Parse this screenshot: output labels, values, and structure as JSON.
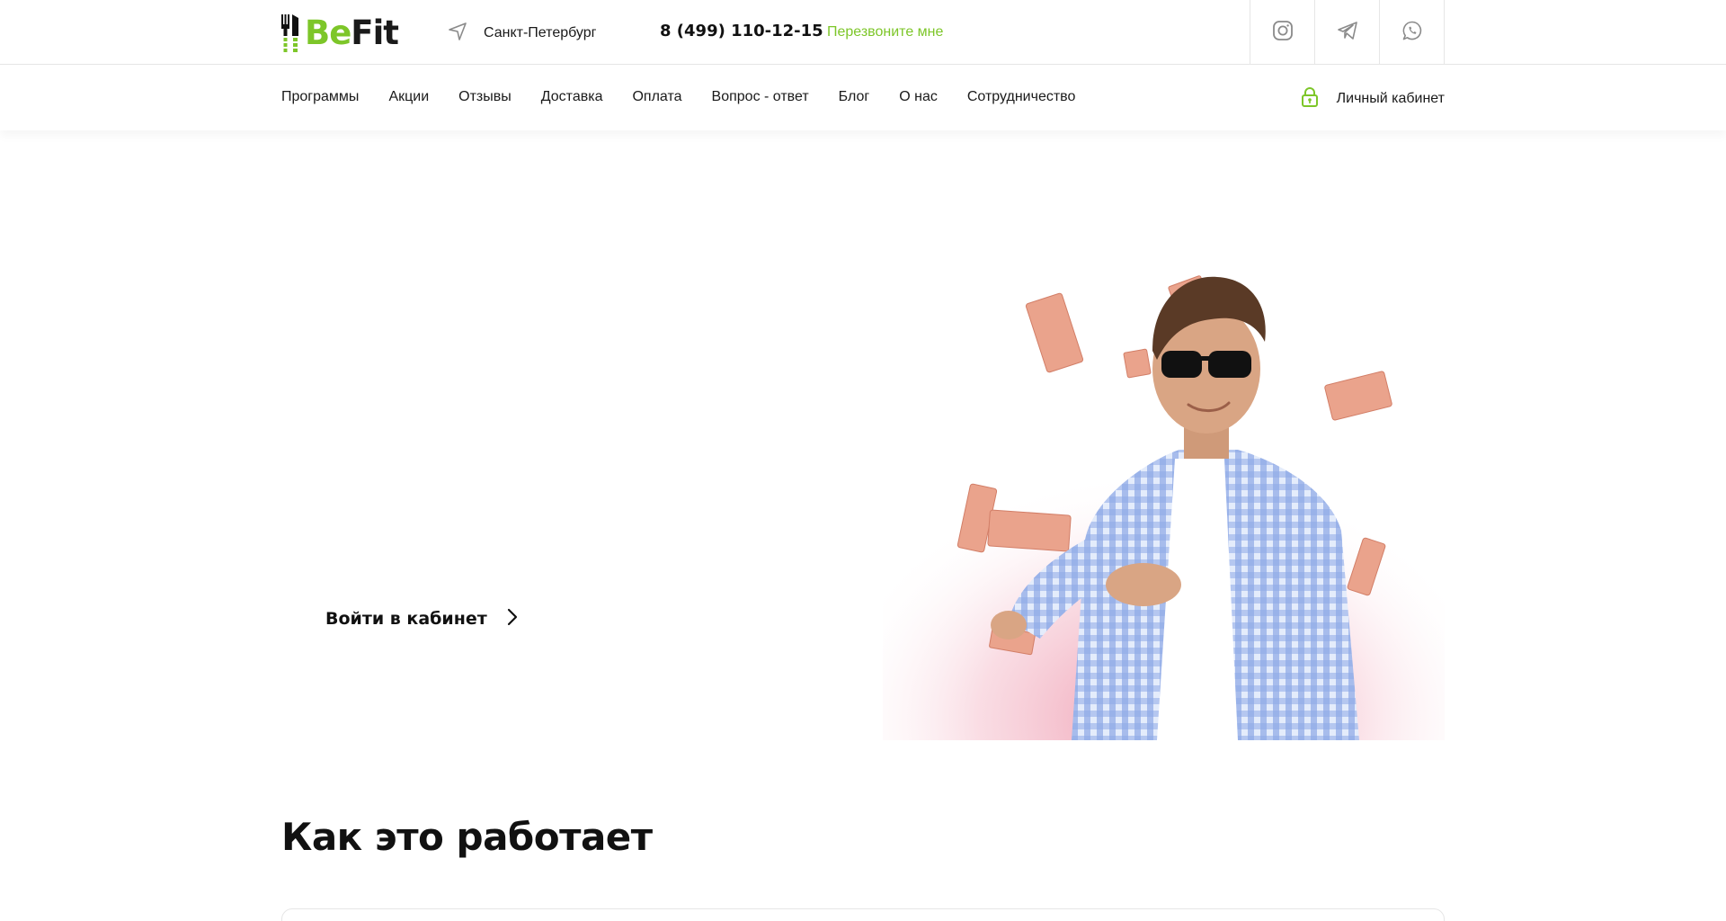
{
  "header": {
    "logo": {
      "part1": "Be",
      "part2": "Fit"
    },
    "city": "Санкт-Петербург",
    "phone": "8 (499) 110-12-15",
    "callback_label": "Перезвоните мне",
    "socials": [
      "instagram-icon",
      "telegram-icon",
      "whatsapp-icon"
    ]
  },
  "nav": {
    "items": [
      {
        "label": "Программы"
      },
      {
        "label": "Акции"
      },
      {
        "label": "Отзывы"
      },
      {
        "label": "Доставка"
      },
      {
        "label": "Оплата"
      },
      {
        "label": "Вопрос - ответ"
      },
      {
        "label": "Блог"
      },
      {
        "label": "О нас"
      },
      {
        "label": "Сотрудничество"
      }
    ],
    "account_label": "Личный кабинет"
  },
  "hero": {
    "cta_label": "Войти в кабинет"
  },
  "section": {
    "title": "Как это работает"
  },
  "colors": {
    "accent": "#7dc629",
    "text": "#1a1a1a",
    "border": "#e6e6e6",
    "banknote": "#e8a08a"
  }
}
